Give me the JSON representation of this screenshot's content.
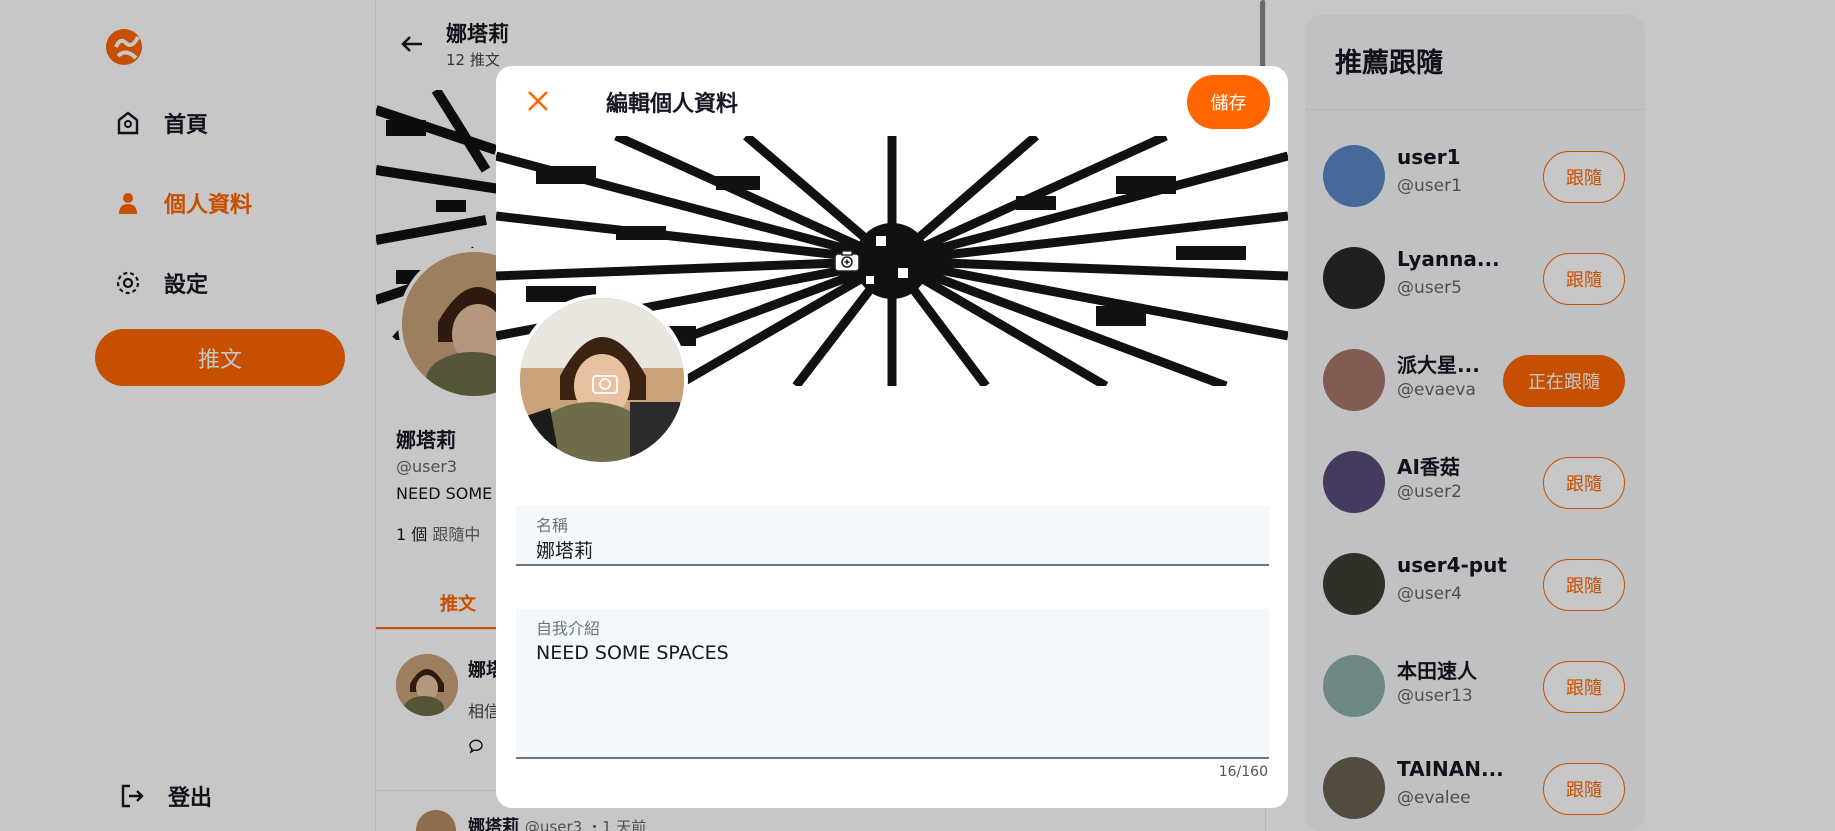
{
  "nav": {
    "items": [
      {
        "label": "首頁",
        "icon": "home-icon"
      },
      {
        "label": "個人資料",
        "icon": "user-icon"
      },
      {
        "label": "設定",
        "icon": "gear-icon"
      }
    ],
    "tweet_button": "推文",
    "logout": "登出"
  },
  "profile": {
    "header_name": "娜塔莉",
    "tweet_count": "12 推文",
    "name": "娜塔莉",
    "handle": "@user3",
    "bio_preview": "NEED SOME",
    "follow_count": "1 個",
    "follow_label": "跟隨中",
    "tab": "推文",
    "tweet_name_preview": "娜塔",
    "tweet_text_preview": "相信",
    "tweet2_name": "娜塔莉",
    "tweet2_meta": "@user3 ・1 天前"
  },
  "recommend": {
    "title": "推薦跟隨",
    "users": [
      {
        "name": "user1",
        "handle": "@user1",
        "button": "跟隨",
        "following": false
      },
      {
        "name": "Lyanna...",
        "handle": "@user5",
        "button": "跟隨",
        "following": false
      },
      {
        "name": "派大星...",
        "handle": "@evaeva",
        "button": "正在跟隨",
        "following": true
      },
      {
        "name": "AI香菇",
        "handle": "@user2",
        "button": "跟隨",
        "following": false
      },
      {
        "name": "user4-put",
        "handle": "@user4",
        "button": "跟隨",
        "following": false
      },
      {
        "name": "本田速人",
        "handle": "@user13",
        "button": "跟隨",
        "following": false
      },
      {
        "name": "TAINAN...",
        "handle": "@evalee",
        "button": "跟隨",
        "following": false
      }
    ]
  },
  "modal": {
    "title": "編輯個人資料",
    "save": "儲存",
    "name_label": "名稱",
    "name_value": "娜塔莉",
    "bio_label": "自我介紹",
    "bio_value": "NEED SOME SPACES",
    "bio_count": "16/160"
  },
  "colors": {
    "accent": "#ff6600"
  }
}
